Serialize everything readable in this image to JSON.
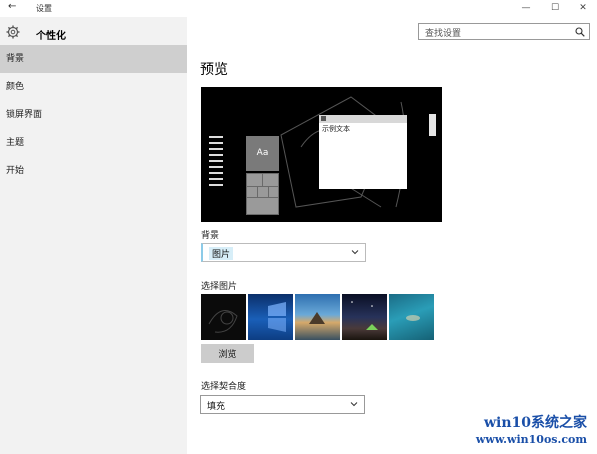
{
  "window": {
    "title": "设置",
    "back_icon": "←",
    "controls": {
      "minimize": "—",
      "maximize": "☐",
      "close": "✕"
    }
  },
  "sidebar": {
    "heading": "个性化",
    "items": [
      {
        "label": "背景",
        "active": true
      },
      {
        "label": "颜色",
        "active": false
      },
      {
        "label": "锁屏界面",
        "active": false
      },
      {
        "label": "主题",
        "active": false
      },
      {
        "label": "开始",
        "active": false
      }
    ]
  },
  "search": {
    "placeholder": "查找设置"
  },
  "main": {
    "title": "预览",
    "preview": {
      "tile_text": "Aa",
      "window_text": "示例文本"
    },
    "background": {
      "label": "背景",
      "value": "图片"
    },
    "choose_picture": {
      "label": "选择图片",
      "thumbnails": [
        "dark-abstract",
        "windows-10-blue",
        "beach-rock",
        "night-sky-tent",
        "underwater-swimmer"
      ]
    },
    "browse_label": "浏览",
    "fit": {
      "label": "选择契合度",
      "value": "填充"
    }
  },
  "watermark": {
    "title": "win10系统之家",
    "url": "www.win10os.com"
  },
  "colors": {
    "sidebar_bg": "#f2f2f2",
    "active_item": "#cfcfcf",
    "accent": "#1a4fa8"
  }
}
